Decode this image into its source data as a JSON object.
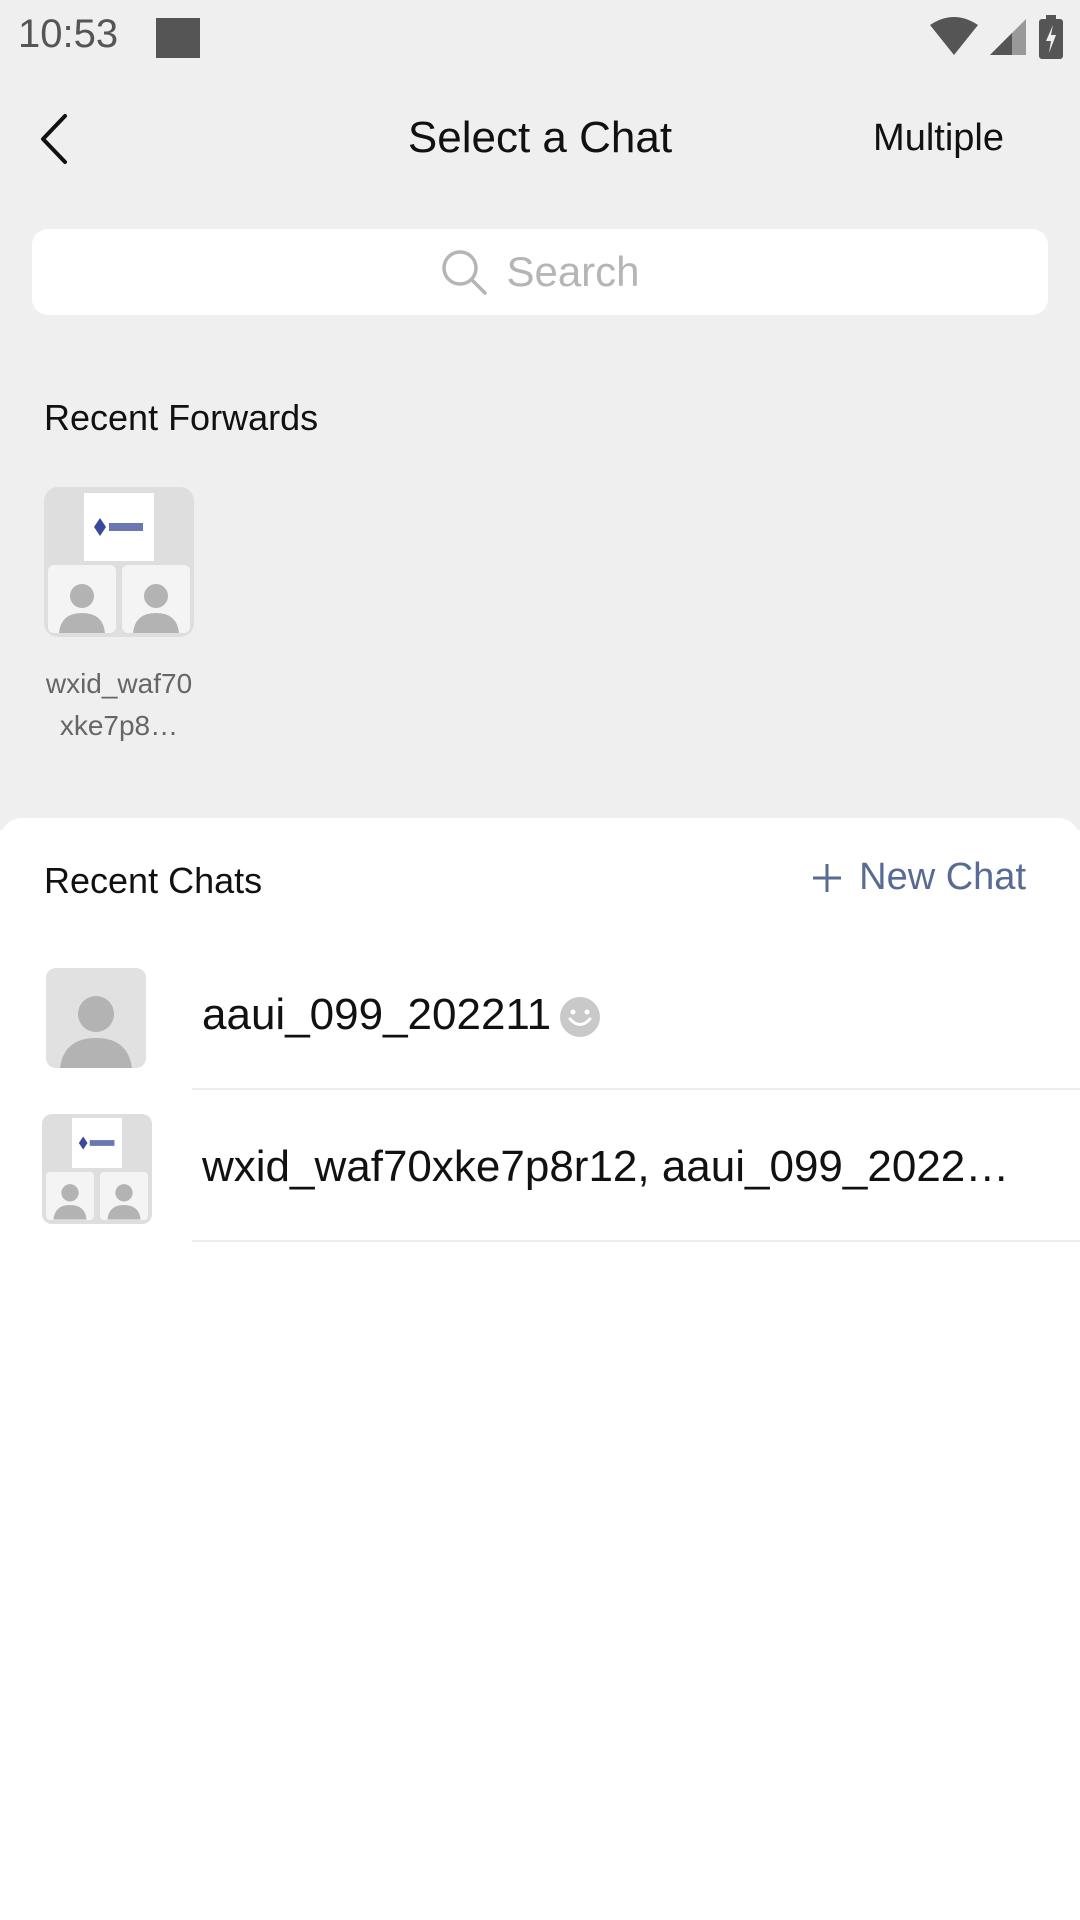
{
  "status_bar": {
    "time": "10:53"
  },
  "nav": {
    "title": "Select a Chat",
    "multiple_label": "Multiple"
  },
  "search": {
    "placeholder": "Search"
  },
  "recent_forwards": {
    "heading": "Recent Forwards",
    "items": [
      {
        "name": "wxid_waf70xke7p8…"
      }
    ]
  },
  "recent_chats": {
    "heading": "Recent Chats",
    "new_chat_label": "New Chat",
    "items": [
      {
        "name": "aaui_099_202211"
      },
      {
        "name": "wxid_waf70xke7p8r12, aaui_099_2022…"
      }
    ]
  },
  "colors": {
    "link": "#576b95",
    "background_top": "#efefef",
    "placeholder": "#b5b5b5"
  },
  "icons": [
    "back-icon",
    "search-icon",
    "plus-icon",
    "wifi-icon",
    "signal-icon",
    "battery-icon",
    "smiley-icon",
    "person-icon"
  ]
}
